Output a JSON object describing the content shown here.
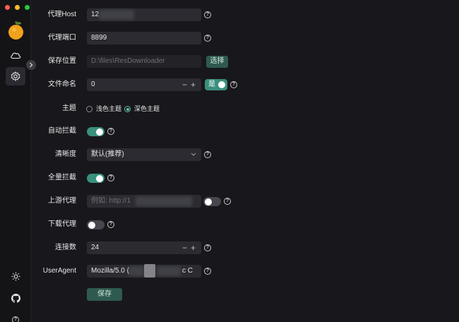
{
  "sidebar": {
    "icons": [
      "cloud-icon",
      "settings-icon",
      "sun-icon",
      "github-icon",
      "help-icon"
    ]
  },
  "fields": {
    "proxy_host": {
      "label": "代理Host",
      "value": "12"
    },
    "proxy_port": {
      "label": "代理端口",
      "value": "8899"
    },
    "save_location": {
      "label": "保存位置",
      "value": "D:\\files\\ResDownloader",
      "button": "选择"
    },
    "file_naming": {
      "label": "文件命名",
      "value": "0",
      "toggle_label": "是"
    },
    "theme": {
      "label": "主题",
      "options": [
        "浅色主题",
        "深色主题"
      ],
      "selected": "深色主题"
    },
    "auto_intercept": {
      "label": "自动拦截",
      "on": true
    },
    "quality": {
      "label": "清晰度",
      "value": "默认(推荐)"
    },
    "full_intercept": {
      "label": "全量拦截",
      "on": true
    },
    "upstream_proxy": {
      "label": "上游代理",
      "placeholder": "例如: http://1",
      "on": false
    },
    "download_proxy": {
      "label": "下载代理",
      "on": false
    },
    "connections": {
      "label": "连接数",
      "value": "24"
    },
    "user_agent": {
      "label": "UserAgent",
      "value": "Mozilla/5.0 (",
      "tail": "c C"
    }
  },
  "actions": {
    "save": "保存"
  },
  "colors": {
    "accent": "#3a8f7d",
    "button": "#2f5a4f",
    "background": "#18181c",
    "field": "#2b2b31"
  }
}
